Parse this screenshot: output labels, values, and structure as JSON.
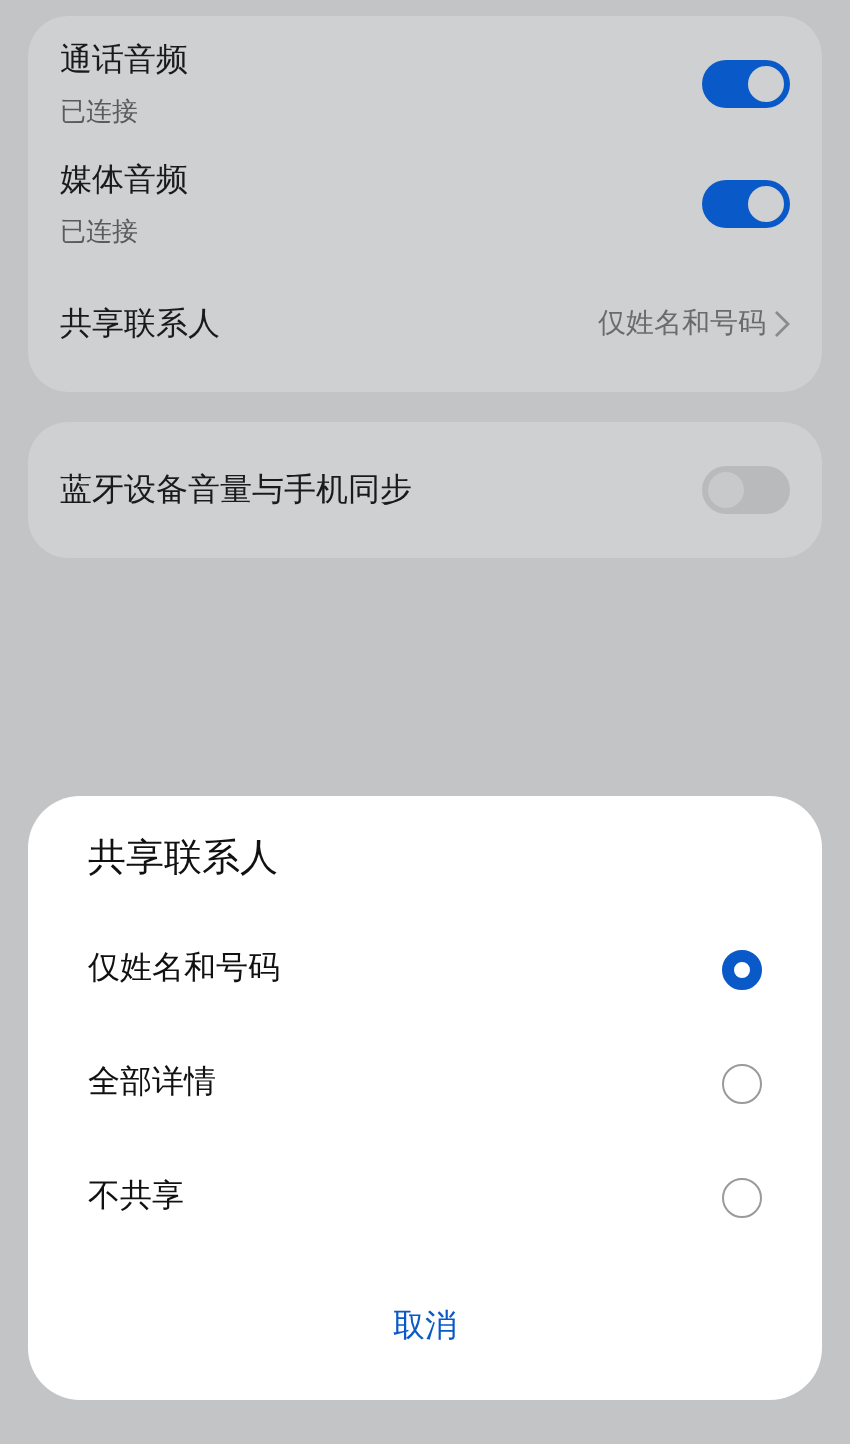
{
  "groups": [
    {
      "rows": [
        {
          "kind": "toggle",
          "title": "通话音频",
          "subtitle": "已连接",
          "on": true
        },
        {
          "kind": "toggle",
          "title": "媒体音频",
          "subtitle": "已连接",
          "on": true
        },
        {
          "kind": "link",
          "title": "共享联系人",
          "value": "仅姓名和号码"
        }
      ]
    },
    {
      "rows": [
        {
          "kind": "toggle",
          "title": "蓝牙设备音量与手机同步",
          "on": false
        }
      ]
    }
  ],
  "sheet": {
    "title": "共享联系人",
    "options": [
      {
        "label": "仅姓名和号码",
        "selected": true
      },
      {
        "label": "全部详情",
        "selected": false
      },
      {
        "label": "不共享",
        "selected": false
      }
    ],
    "cancel": "取消"
  }
}
